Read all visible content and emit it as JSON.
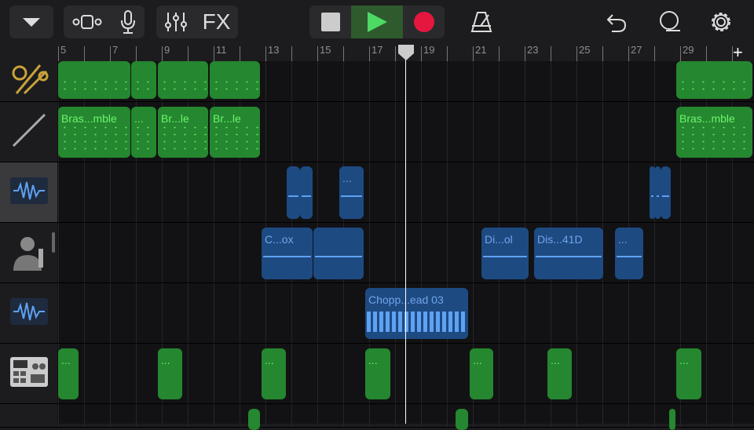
{
  "toolbar": {
    "fx_label": "FX",
    "colors": {
      "play": "#4cd964",
      "record": "#e5173f",
      "region_green": "#25872f",
      "region_blue": "#1e4a82"
    }
  },
  "ruler": {
    "bars": [
      "5",
      "7",
      "9",
      "11",
      "13",
      "15",
      "17",
      "19",
      "21",
      "23",
      "25",
      "27",
      "29"
    ],
    "add_label": "+"
  },
  "tracks": [
    {
      "name": "brass-track",
      "icon": "brass-instruments-icon"
    },
    {
      "name": "woodwind-track",
      "icon": "clarinet-icon"
    },
    {
      "name": "audio-track-1",
      "icon": "waveform-icon"
    },
    {
      "name": "vocal-track",
      "icon": "microphone-singer-icon"
    },
    {
      "name": "audio-track-2",
      "icon": "waveform-icon"
    },
    {
      "name": "drum-machine-track",
      "icon": "beat-sequencer-icon"
    }
  ],
  "regions": {
    "row2": [
      "Bras...mble",
      "...",
      "Br...le",
      "Br...le",
      "Bras...mble"
    ],
    "row3": [
      "",
      "",
      "..."
    ],
    "row4": [
      "C...ox",
      "",
      "Di...ol",
      "Dis...41D",
      "..."
    ],
    "row5": [
      "Chopp...ead 03"
    ],
    "row6": [
      "...",
      "...",
      "...",
      "...",
      "...",
      "...",
      "..."
    ]
  }
}
